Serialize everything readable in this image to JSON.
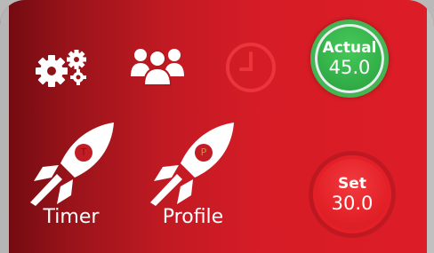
{
  "nav": {
    "settings_icon": "gears-icon",
    "users_icon": "users-icon",
    "clock_icon": "clock-icon"
  },
  "rockets": [
    {
      "label": "Timer",
      "badge": "T",
      "badge_color": "#c21c24"
    },
    {
      "label": "Profile",
      "badge": "P",
      "badge_color": "#8bb52a"
    }
  ],
  "readouts": {
    "actual": {
      "title": "Actual",
      "value": "45.0",
      "color": "#34b24a"
    },
    "set": {
      "title": "Set",
      "value": "30.0",
      "color": "#e32228"
    }
  }
}
